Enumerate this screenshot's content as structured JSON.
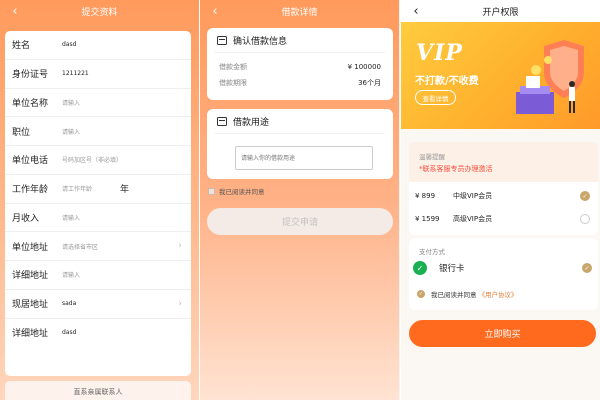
{
  "screen1": {
    "title": "提交资料",
    "rows": [
      {
        "label": "姓名",
        "value": "dasd"
      },
      {
        "label": "身份证号",
        "value": "1211221"
      },
      {
        "label": "单位名称",
        "placeholder": "请输入"
      },
      {
        "label": "职位",
        "placeholder": "请输入"
      },
      {
        "label": "单位电话",
        "placeholder": "号码加区号（非必填）"
      },
      {
        "label": "工作年龄",
        "placeholder": "请工作年龄",
        "unit": "年"
      },
      {
        "label": "月收入",
        "placeholder": "请输入"
      },
      {
        "label": "单位地址",
        "placeholder": "请选择省市区"
      },
      {
        "label": "详细地址",
        "placeholder": "请输入"
      },
      {
        "label": "现居地址",
        "value": "sada"
      },
      {
        "label": "详细地址",
        "value": "dasd"
      }
    ],
    "contact_strip": "直系亲属联系人",
    "icons": {
      "back": "back-arrow-icon",
      "chevron": "chevron-right-icon"
    }
  },
  "screen2": {
    "title": "借款详情",
    "confirm": {
      "header": "确认借款信息",
      "rows": [
        {
          "key": "借款金额",
          "value": "¥ 100000"
        },
        {
          "key": "借款期限",
          "value": "36个月"
        }
      ]
    },
    "purpose": {
      "header": "借款用途",
      "placeholder": "请输入你的借款用途"
    },
    "agree_text": "我已阅读并同意",
    "agree_link": "",
    "submit_label": "提交申请"
  },
  "screen3": {
    "title": "开户权限",
    "banner": {
      "title": "VIP",
      "subtitle": "不打款/不收费",
      "detail_label": "查看详情"
    },
    "tip": {
      "title": "温馨提醒",
      "text": "*联系客服专员办理激活"
    },
    "options": [
      {
        "price": "¥ 899",
        "name": "中级VIP会员",
        "selected": true
      },
      {
        "price": "¥ 1599",
        "name": "高级VIP会员",
        "selected": false
      }
    ],
    "payment": {
      "title": "支付方式",
      "method": "银行卡",
      "selected": true
    },
    "agree_text": "我已阅读并同意",
    "agree_link": "《用户协议》",
    "buy_label": "立即购买",
    "colors": {
      "accent": "#ff6a1f",
      "gold": "#c9a66b",
      "alert": "#ff4b3a"
    }
  }
}
